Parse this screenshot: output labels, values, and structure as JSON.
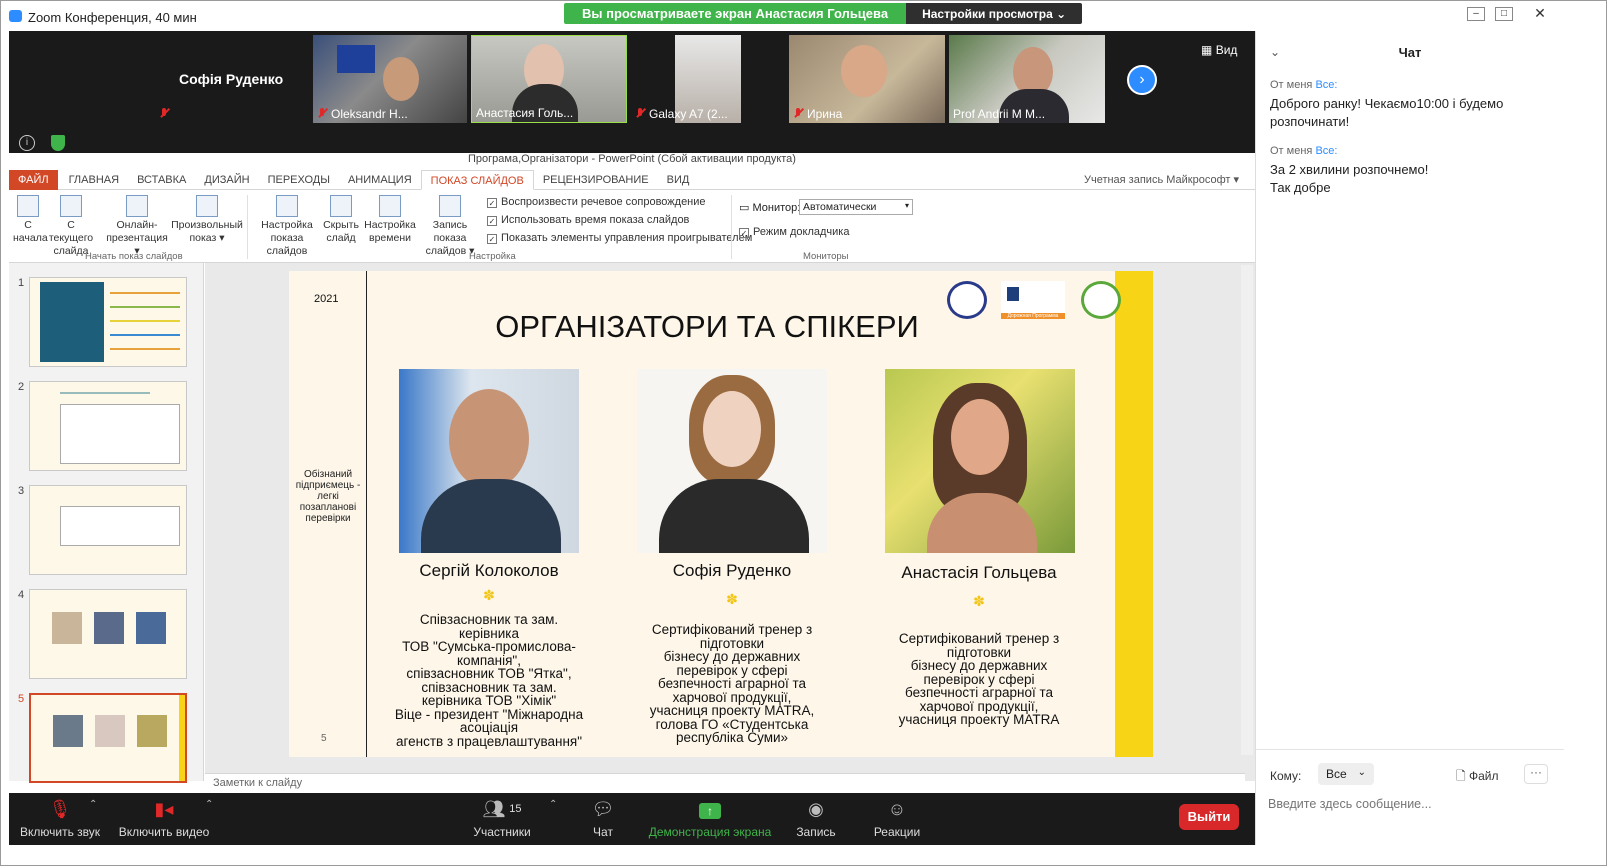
{
  "window": {
    "title": "Zoom Конференция, 40 мин",
    "share_banner": "Вы просматриваете экран Анастасия Гольцева",
    "view_settings": "Настройки просмотра ⌄"
  },
  "strip": {
    "first_name": "Софія Руденко",
    "participants": [
      {
        "name": "Oleksandr H...",
        "muted": true
      },
      {
        "name": "Анастасия Голь...",
        "muted": false
      },
      {
        "name": "Galaxy A7 (2...",
        "muted": true
      },
      {
        "name": "Ирина",
        "muted": true
      },
      {
        "name": "Prof Andrii M M...",
        "muted": false
      }
    ],
    "view_label": "Вид"
  },
  "powerpoint": {
    "title": "Програма,Організатори - PowerPoint (Сбой активации продукта)",
    "tabs": [
      "ФАЙЛ",
      "ГЛАВНАЯ",
      "ВСТАВКА",
      "ДИЗАЙН",
      "ПЕРЕХОДЫ",
      "АНИМАЦИЯ",
      "ПОКАЗ СЛАЙДОВ",
      "РЕЦЕНЗИРОВАНИЕ",
      "ВИД"
    ],
    "account": "Учетная запись Майкрософт ▾",
    "ribbon": {
      "from_start_1": "С",
      "from_start_2": "начала",
      "from_current_1": "С текущего",
      "from_current_2": "слайда",
      "online_1": "Онлайн-",
      "online_2": "презентация ▾",
      "custom_1": "Произвольный",
      "custom_2": "показ ▾",
      "group_start": "Начать показ слайдов",
      "setup_1": "Настройка",
      "setup_2": "показа слайдов",
      "hide_1": "Скрыть",
      "hide_2": "слайд",
      "timing_1": "Настройка",
      "timing_2": "времени",
      "record_1": "Запись показа",
      "record_2": "слайдов ▾",
      "chk1": "Воспроизвести речевое сопровождение",
      "chk2": "Использовать время показа слайдов",
      "chk3": "Показать элементы управления проигрывателем",
      "group_setup": "Настройка",
      "monitor_label": "Монитор:",
      "monitor_value": "Автоматически",
      "presenter_view": "Режим докладчика",
      "group_monitors": "Мониторы"
    },
    "thumbnails": [
      "1",
      "2",
      "3",
      "4",
      "5"
    ],
    "notes": "Заметки к слайду"
  },
  "slide": {
    "year": "2021",
    "title": "ОРГАНІЗАТОРИ ТА СПІКЕРИ",
    "side_text": "Обізнаний підприємець - легкі позапланові перевірки",
    "number": "5",
    "logo2_text": "Дорожная Программа",
    "people": [
      {
        "name": "Сергій Колоколов",
        "desc": [
          "Співзасновник та зам.",
          "керівника",
          "ТОВ \"Сумська-промислова-",
          "компанія\",",
          "співзасновник ТОВ \"Ятка\",",
          "співзасновник та зам.",
          "керівника ТОВ \"Хімік\"",
          "Віце - президент \"Міжнародна",
          "асоціація",
          "агенств з працевлаштування\""
        ]
      },
      {
        "name": "Софія Руденко",
        "desc": [
          "Сертифікований тренер з",
          "підготовки",
          "бізнесу до державних",
          "перевірок у сфері",
          "безпечності аграрної та",
          "харчової продукції,",
          "учасниця проекту MATRA,",
          "голова ГО «Студентська",
          "республіка Суми»"
        ]
      },
      {
        "name": "Анастасія Гольцева",
        "desc": [
          "Сертифікований тренер з",
          "підготовки",
          "бізнесу до державних",
          "перевірок у сфері",
          "безпечності аграрної та",
          "харчової продукції,",
          "учасниця проекту MATRA"
        ]
      }
    ]
  },
  "toolbar": {
    "unmute": "Включить звук",
    "start_video": "Включить видео",
    "participants": "Участники",
    "participants_count": "15",
    "chat": "Чат",
    "share": "Демонстрация экрана",
    "record": "Запись",
    "reactions": "Реакции",
    "leave": "Выйти"
  },
  "chat": {
    "title": "Чат",
    "messages": [
      {
        "from": "От меня",
        "to": "Все:",
        "lines": [
          "Доброго ранку! Чекаємо10:00 і будемо розпочинати!"
        ]
      },
      {
        "from": "От меня",
        "to": "Все:",
        "lines": [
          "За 2 хвилини розпочнемо!",
          "Так добре"
        ]
      }
    ],
    "to_label": "Кому:",
    "to_value": "Все",
    "file_label": "Файл",
    "placeholder": "Введите здесь сообщение..."
  },
  "colors": {
    "zoom_blue": "#2d8cff",
    "share_green": "#3fb44a",
    "leave_red": "#d8282a",
    "ppt_accent": "#d24726",
    "slide_yellow": "#f7d516"
  }
}
